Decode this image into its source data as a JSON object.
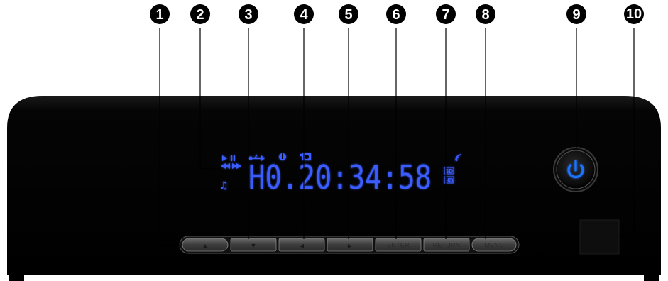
{
  "callouts": [
    "1",
    "2",
    "3",
    "4",
    "5",
    "6",
    "7",
    "8",
    "9",
    "10"
  ],
  "display": {
    "time_text": "H0.20:34:58",
    "hd_label": "HD",
    "sd_label": "SD"
  },
  "buttons": [
    {
      "label": "",
      "icon": "arrow-up-icon",
      "glyph": "▲"
    },
    {
      "label": "",
      "icon": "arrow-down-icon",
      "glyph": "▼"
    },
    {
      "label": "",
      "icon": "arrow-left-icon",
      "glyph": "◀"
    },
    {
      "label": "",
      "icon": "arrow-right-icon",
      "glyph": "▶"
    },
    {
      "label": "ENTER",
      "icon": "",
      "glyph": ""
    },
    {
      "label": "RETURN",
      "icon": "",
      "glyph": ""
    },
    {
      "label": "MENU",
      "icon": "",
      "glyph": ""
    }
  ],
  "colors": {
    "body": "#050505",
    "vfd_blue": "#3a5cff",
    "power_blue": "#1e73ff",
    "button_face": "#3c3c3c"
  }
}
